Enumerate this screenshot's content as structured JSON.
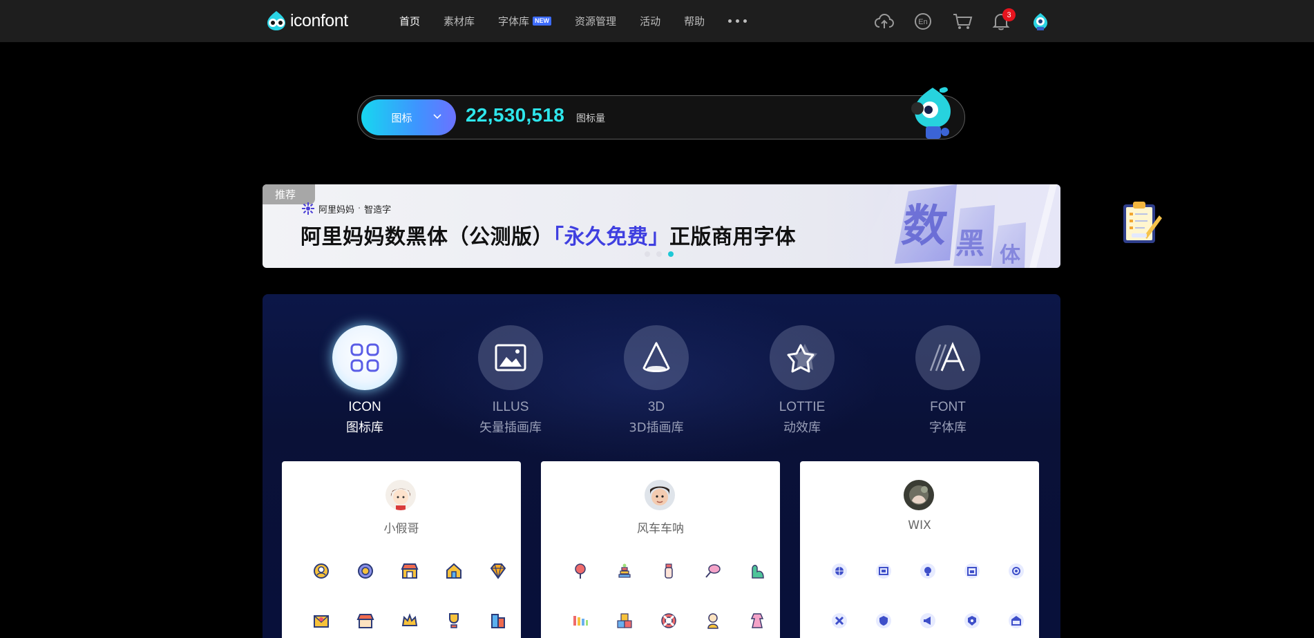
{
  "header": {
    "logo_text": "iconfont",
    "nav": [
      {
        "label": "首页",
        "active": true
      },
      {
        "label": "素材库"
      },
      {
        "label": "字体库",
        "badge": "NEW"
      },
      {
        "label": "资源管理"
      },
      {
        "label": "活动"
      },
      {
        "label": "帮助"
      }
    ],
    "notification_count": "3",
    "icons": [
      "upload-cloud-icon",
      "language-en-icon",
      "cart-icon",
      "bell-icon",
      "user-avatar-icon"
    ]
  },
  "search": {
    "type_label": "图标",
    "count": "22,530,518",
    "count_label": "图标量"
  },
  "banner": {
    "tag": "推荐",
    "brand": "阿里妈妈",
    "brand_sep": "·",
    "brand_sub": "智造字",
    "title_before": "阿里妈妈数黑体（公测版）",
    "title_highlight": "「永久免费」",
    "title_after": "正版商用字体",
    "active_slide": 3,
    "slide_count": 3
  },
  "categories": [
    {
      "en": "ICON",
      "cn": "图标库",
      "active": true,
      "icon": "grid-icon"
    },
    {
      "en": "ILLUS",
      "cn": "矢量插画库",
      "icon": "image-icon"
    },
    {
      "en": "3D",
      "cn": "3D插画库",
      "icon": "cone-icon"
    },
    {
      "en": "LOTTIE",
      "cn": "动效库",
      "icon": "motion-star-icon"
    },
    {
      "en": "FONT",
      "cn": "字体库",
      "icon": "font-a-icon"
    }
  ],
  "cards": [
    {
      "name": "小假哥",
      "accent": "#f0a028"
    },
    {
      "name": "风车车呐",
      "accent": "#e06b7a"
    },
    {
      "name": "WIX",
      "accent": "#4a5bd6"
    }
  ]
}
